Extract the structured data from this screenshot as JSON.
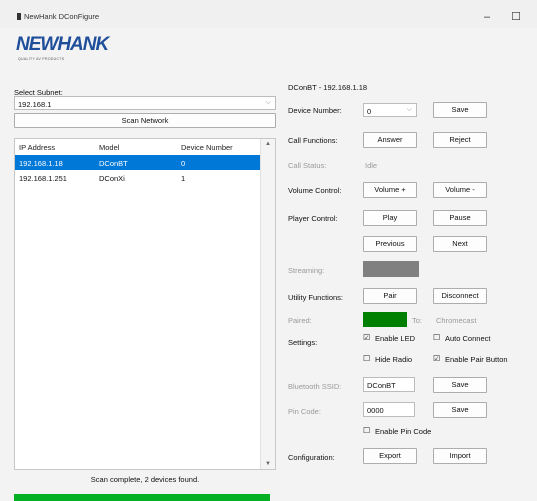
{
  "window": {
    "title": "NewHank DConFigure",
    "minimize": "–",
    "maximize": "☐"
  },
  "logo": {
    "text": "NEWHANK",
    "subtitle": "QUALITY AV PRODUCTS"
  },
  "subnet": {
    "label": "Select Subnet:",
    "value": "192.168.1"
  },
  "scan_button": "Scan Network",
  "table": {
    "headers": [
      "IP Address",
      "Model",
      "Device Number"
    ],
    "rows": [
      [
        "192.168.1.18",
        "DConBT",
        "0"
      ],
      [
        "192.168.1.251",
        "DConXi",
        "1"
      ]
    ]
  },
  "status_text": "Scan complete, 2 devices found.",
  "progress": {
    "percent": 100,
    "color": "#06b025"
  },
  "device": {
    "heading": "DConBT - 192.168.1.18",
    "device_number_label": "Device Number:",
    "device_number_value": "0",
    "save": "Save",
    "call_functions_label": "Call Functions:",
    "answer": "Answer",
    "reject": "Reject",
    "call_status_label": "Call Status:",
    "call_status_value": "Idle",
    "volume_label": "Volume Control:",
    "volume_up": "Volume +",
    "volume_down": "Volume -",
    "player_label": "Player Control:",
    "play": "Play",
    "pause": "Pause",
    "previous": "Previous",
    "next": "Next",
    "streaming_label": "Streaming:",
    "utility_label": "Utility Functions:",
    "pair": "Pair",
    "disconnect": "Disconnect",
    "paired_label": "Paired:",
    "paired_to": "To:",
    "paired_device": "Chromecast",
    "settings_label": "Settings:",
    "enable_led": "Enable LED",
    "auto_connect": "Auto Connect",
    "hide_radio": "Hide Radio",
    "enable_pair_button": "Enable Pair Button",
    "ssid_label": "Bluetooth SSID:",
    "ssid_value": "DConBT",
    "pin_label": "Pin Code:",
    "pin_value": "0000",
    "enable_pin_code": "Enable Pin Code",
    "config_label": "Configuration:",
    "export": "Export",
    "import": "Import"
  },
  "checks": {
    "checked": "☑",
    "unchecked": "☐"
  },
  "colors": {
    "accent": "#0078d7",
    "paired": "#008000",
    "streaming": "#808080"
  }
}
